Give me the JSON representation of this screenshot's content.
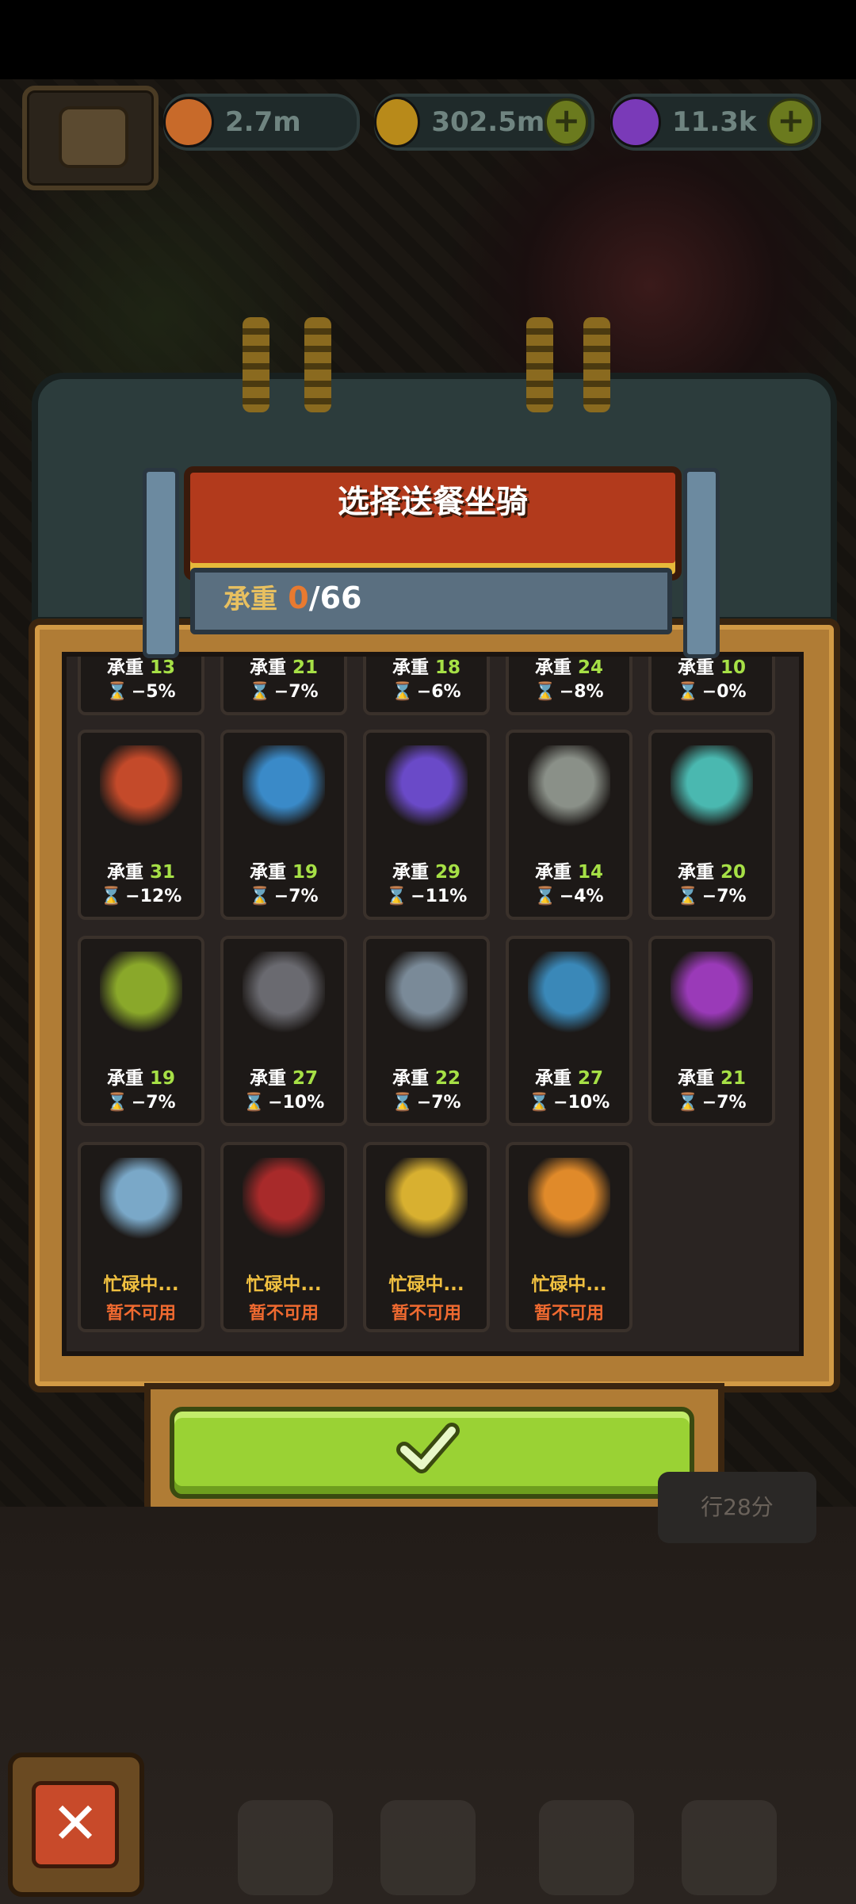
{
  "resources": {
    "eyes": "2.7m",
    "coins": "302.5m",
    "potions": "11.3k",
    "plus": "+"
  },
  "dialog": {
    "title": "选择送餐坐骑",
    "weight_label": "承重",
    "weight_current": "0",
    "weight_sep": "/",
    "weight_max": "66"
  },
  "side_label": "行28分",
  "partial_row": [
    {
      "weight_label": "承重",
      "weight": "13",
      "time": "−5%"
    },
    {
      "weight_label": "承重",
      "weight": "21",
      "time": "−7%"
    },
    {
      "weight_label": "承重",
      "weight": "18",
      "time": "−6%"
    },
    {
      "weight_label": "承重",
      "weight": "24",
      "time": "−8%"
    },
    {
      "weight_label": "承重",
      "weight": "10",
      "time": "−0%"
    }
  ],
  "mounts": [
    {
      "icon": "lion-dance-mount-icon",
      "color": "#c44a2a",
      "weight_label": "承重",
      "weight": "31",
      "time": "−12%"
    },
    {
      "icon": "clown-mount-icon",
      "color": "#3a8ac8",
      "weight_label": "承重",
      "weight": "19",
      "time": "−7%"
    },
    {
      "icon": "rose-mount-icon",
      "color": "#6a4ac8",
      "weight_label": "承重",
      "weight": "29",
      "time": "−11%"
    },
    {
      "icon": "robot-mount-icon",
      "color": "#8a9088",
      "weight_label": "承重",
      "weight": "14",
      "time": "−4%"
    },
    {
      "icon": "teal-monster-mount-icon",
      "color": "#4ab8b0",
      "weight_label": "承重",
      "weight": "20",
      "time": "−7%"
    },
    {
      "icon": "tree-monster-mount-icon",
      "color": "#8aa82a",
      "weight_label": "承重",
      "weight": "19",
      "time": "−7%"
    },
    {
      "icon": "spider-machine-mount-icon",
      "color": "#6a6a70",
      "weight_label": "承重",
      "weight": "27",
      "time": "−10%"
    },
    {
      "icon": "crane-machine-mount-icon",
      "color": "#7a8a98",
      "weight_label": "承重",
      "weight": "22",
      "time": "−7%"
    },
    {
      "icon": "blue-fish-mount-icon",
      "color": "#3a88b8",
      "weight_label": "承重",
      "weight": "27",
      "time": "−10%"
    },
    {
      "icon": "purple-demon-mount-icon",
      "color": "#9a3ab8",
      "weight_label": "承重",
      "weight": "21",
      "time": "−7%"
    }
  ],
  "busy_mounts": [
    {
      "icon": "ufo-mount-icon",
      "color": "#7aa8c8",
      "status": "忙碌中...",
      "note": "暂不可用"
    },
    {
      "icon": "red-throne-mount-icon",
      "color": "#a82a2a",
      "status": "忙碌中...",
      "note": "暂不可用"
    },
    {
      "icon": "yellow-blob-mount-icon",
      "color": "#d8b030",
      "status": "忙碌中...",
      "note": "暂不可用"
    },
    {
      "icon": "bubble-fish-mount-icon",
      "color": "#e08a2a",
      "status": "忙碌中...",
      "note": "暂不可用"
    }
  ]
}
